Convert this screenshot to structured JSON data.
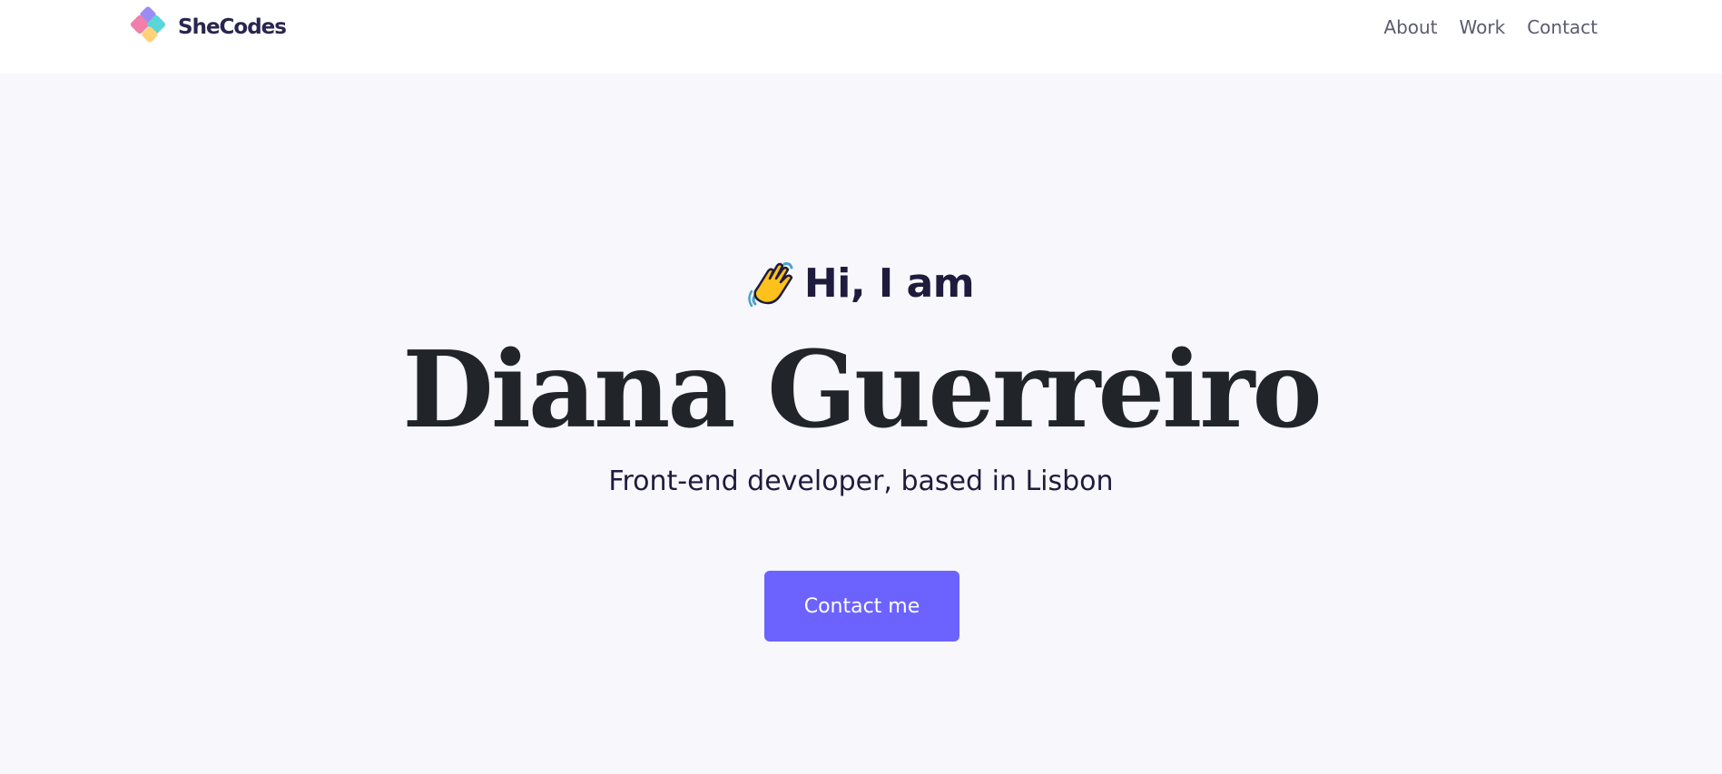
{
  "navbar": {
    "brand": "SheCodes",
    "links": [
      "About",
      "Work",
      "Contact"
    ]
  },
  "hero": {
    "greeting": "Hi, I am",
    "greeting_icon": "waving-hand-icon",
    "name": "Diana Guerreiro",
    "tagline": "Front-end developer, based in Lisbon",
    "cta_label": "Contact me"
  },
  "colors": {
    "background": "#f7f7fc",
    "navbar": "#ffffff",
    "accent": "#6c63ff",
    "heading": "#212529",
    "text_dark": "#1f1b3d",
    "nav_text": "#5b5b72"
  }
}
